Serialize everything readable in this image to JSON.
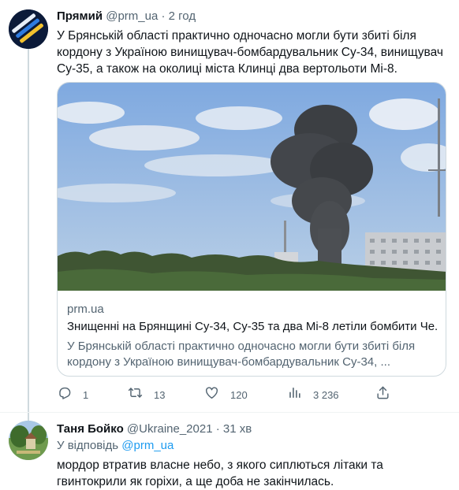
{
  "tweet": {
    "author_name": "Прямий",
    "author_handle": "@prm_ua",
    "separator": "·",
    "time": "2 год",
    "text": "У Брянській області практично одночасно могли бути збиті біля кордону з Україною винищувач-бомбардувальник Су-34, винищувач Су-35, а також на околиці міста Клинці два вертольоти Мі-8.",
    "card": {
      "domain": "prm.ua",
      "title": "Знищенні на Брянщині Су-34, Су-35 та два Мі-8 летіли бомбити Че...",
      "description": "У Брянській області практично одночасно могли бути збиті біля кордону з Україною винищувач-бомбардувальник Су-34, ..."
    },
    "actions": {
      "replies": "1",
      "retweets": "13",
      "likes": "120",
      "views": "3 236"
    }
  },
  "reply": {
    "author_name": "Таня Бойко",
    "author_handle": "@Ukraine_2021",
    "separator": "·",
    "time": "31 хв",
    "reply_prefix": "У відповідь",
    "reply_target": "@prm_ua",
    "text": "мордор втратив власне небо, з якого сиплються літаки та гвинтокрили як горіхи, а ще доба не закінчилась."
  },
  "icons": {
    "reply": "reply-icon",
    "retweet": "retweet-icon",
    "like": "heart-icon",
    "views": "views-icon",
    "share": "share-icon"
  },
  "colors": {
    "text": "#0f1419",
    "secondary": "#536471",
    "link": "#1d9bf0",
    "border": "#cfd9de"
  }
}
